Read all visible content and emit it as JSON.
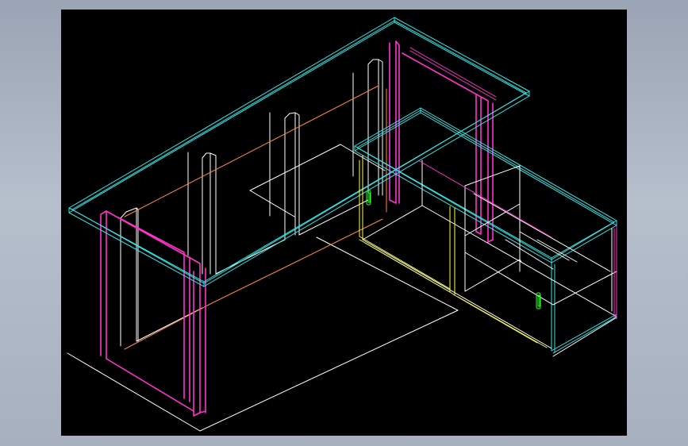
{
  "colors": {
    "background": "#000000",
    "window": "#a7b0bf",
    "desktop_top": "#cc33ff",
    "edge_cyan": "#33e6e6",
    "leg_magenta": "#ff33cc",
    "body_white": "#ffffff",
    "rail_orange": "#ff8844",
    "cabinet_yellow": "#ffff44",
    "handle_green": "#33ff33"
  },
  "icons": {
    "handle": "cabinet-handle-icon"
  }
}
